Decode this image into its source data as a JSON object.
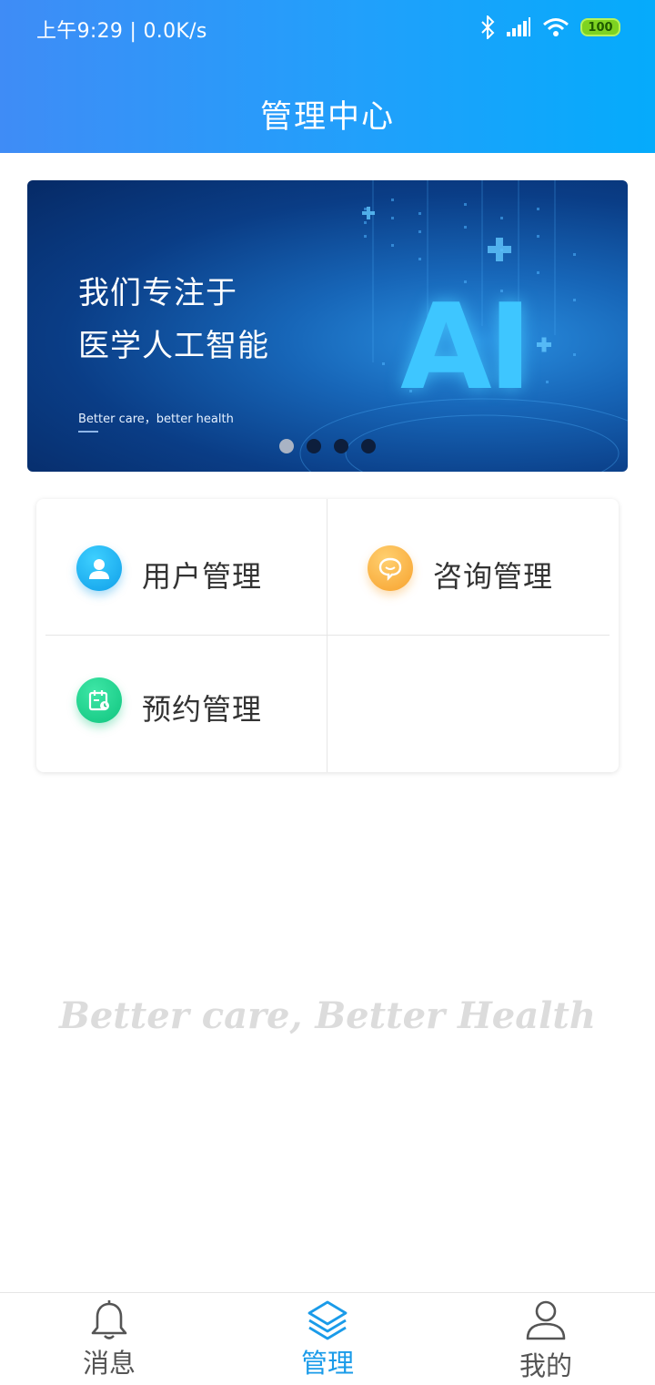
{
  "status_bar": {
    "time_speed": "上午9:29 | 0.0K/s",
    "battery": "100",
    "icons": [
      "bluetooth-icon",
      "signal-icon",
      "wifi-icon",
      "battery-icon"
    ]
  },
  "header": {
    "title": "管理中心"
  },
  "banner": {
    "line1": "我们专注于",
    "line2": "医学人工智能",
    "tagline": "Better care，better health",
    "art_text": "AI",
    "slide_count": 4,
    "active_slide": 1
  },
  "menu": {
    "items": [
      {
        "label": "用户管理",
        "icon": "user-icon",
        "color": "#18b3f5"
      },
      {
        "label": "咨询管理",
        "icon": "chat-bubble-icon",
        "color": "#fbb13c"
      },
      {
        "label": "预约管理",
        "icon": "calendar-icon",
        "color": "#1bd18f"
      }
    ]
  },
  "watermark": "Better care, Better Health",
  "tab_bar": {
    "tabs": [
      {
        "label": "消息",
        "icon": "bell-icon",
        "active": false
      },
      {
        "label": "管理",
        "icon": "layers-icon",
        "active": true
      },
      {
        "label": "我的",
        "icon": "person-icon",
        "active": false
      }
    ],
    "active_color": "#1a9be9"
  },
  "colors": {
    "header_gradient_start": "#3f8cf6",
    "header_gradient_end": "#05abfb",
    "banner_bg": "#0a3d86"
  }
}
